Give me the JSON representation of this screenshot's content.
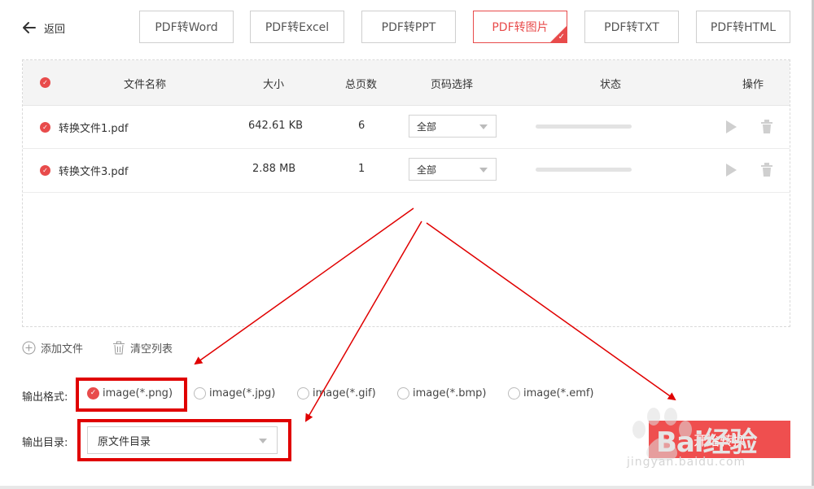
{
  "header": {
    "back_label": "返回",
    "tabs": [
      {
        "label": "PDF转Word",
        "active": false
      },
      {
        "label": "PDF转Excel",
        "active": false
      },
      {
        "label": "PDF转PPT",
        "active": false
      },
      {
        "label": "PDF转图片",
        "active": true
      },
      {
        "label": "PDF转TXT",
        "active": false
      },
      {
        "label": "PDF转HTML",
        "active": false
      }
    ]
  },
  "table": {
    "columns": {
      "name": "文件名称",
      "size": "大小",
      "pages": "总页数",
      "page_select": "页码选择",
      "status": "状态",
      "actions": "操作"
    },
    "rows": [
      {
        "name": "转换文件1.pdf",
        "size": "642.61 KB",
        "pages": "6",
        "page_select": "全部",
        "progress": 0
      },
      {
        "name": "转换文件3.pdf",
        "size": "2.88 MB",
        "pages": "1",
        "page_select": "全部",
        "progress": 0
      }
    ]
  },
  "toolbar": {
    "add_file": "添加文件",
    "clear_list": "清空列表"
  },
  "output": {
    "format_label": "输出格式:",
    "formats": [
      {
        "label": "image(*.png)",
        "selected": true
      },
      {
        "label": "image(*.jpg)",
        "selected": false
      },
      {
        "label": "image(*.gif)",
        "selected": false
      },
      {
        "label": "image(*.bmp)",
        "selected": false
      },
      {
        "label": "image(*.emf)",
        "selected": false
      }
    ],
    "dir_label": "输出目录:",
    "dir_value": "原文件目录",
    "start_button": "开始转换"
  },
  "watermark": {
    "brand": "Bai经验",
    "url": "jingyan.baidu.com"
  },
  "colors": {
    "accent": "#e84b4b",
    "annotation": "#e00000"
  }
}
